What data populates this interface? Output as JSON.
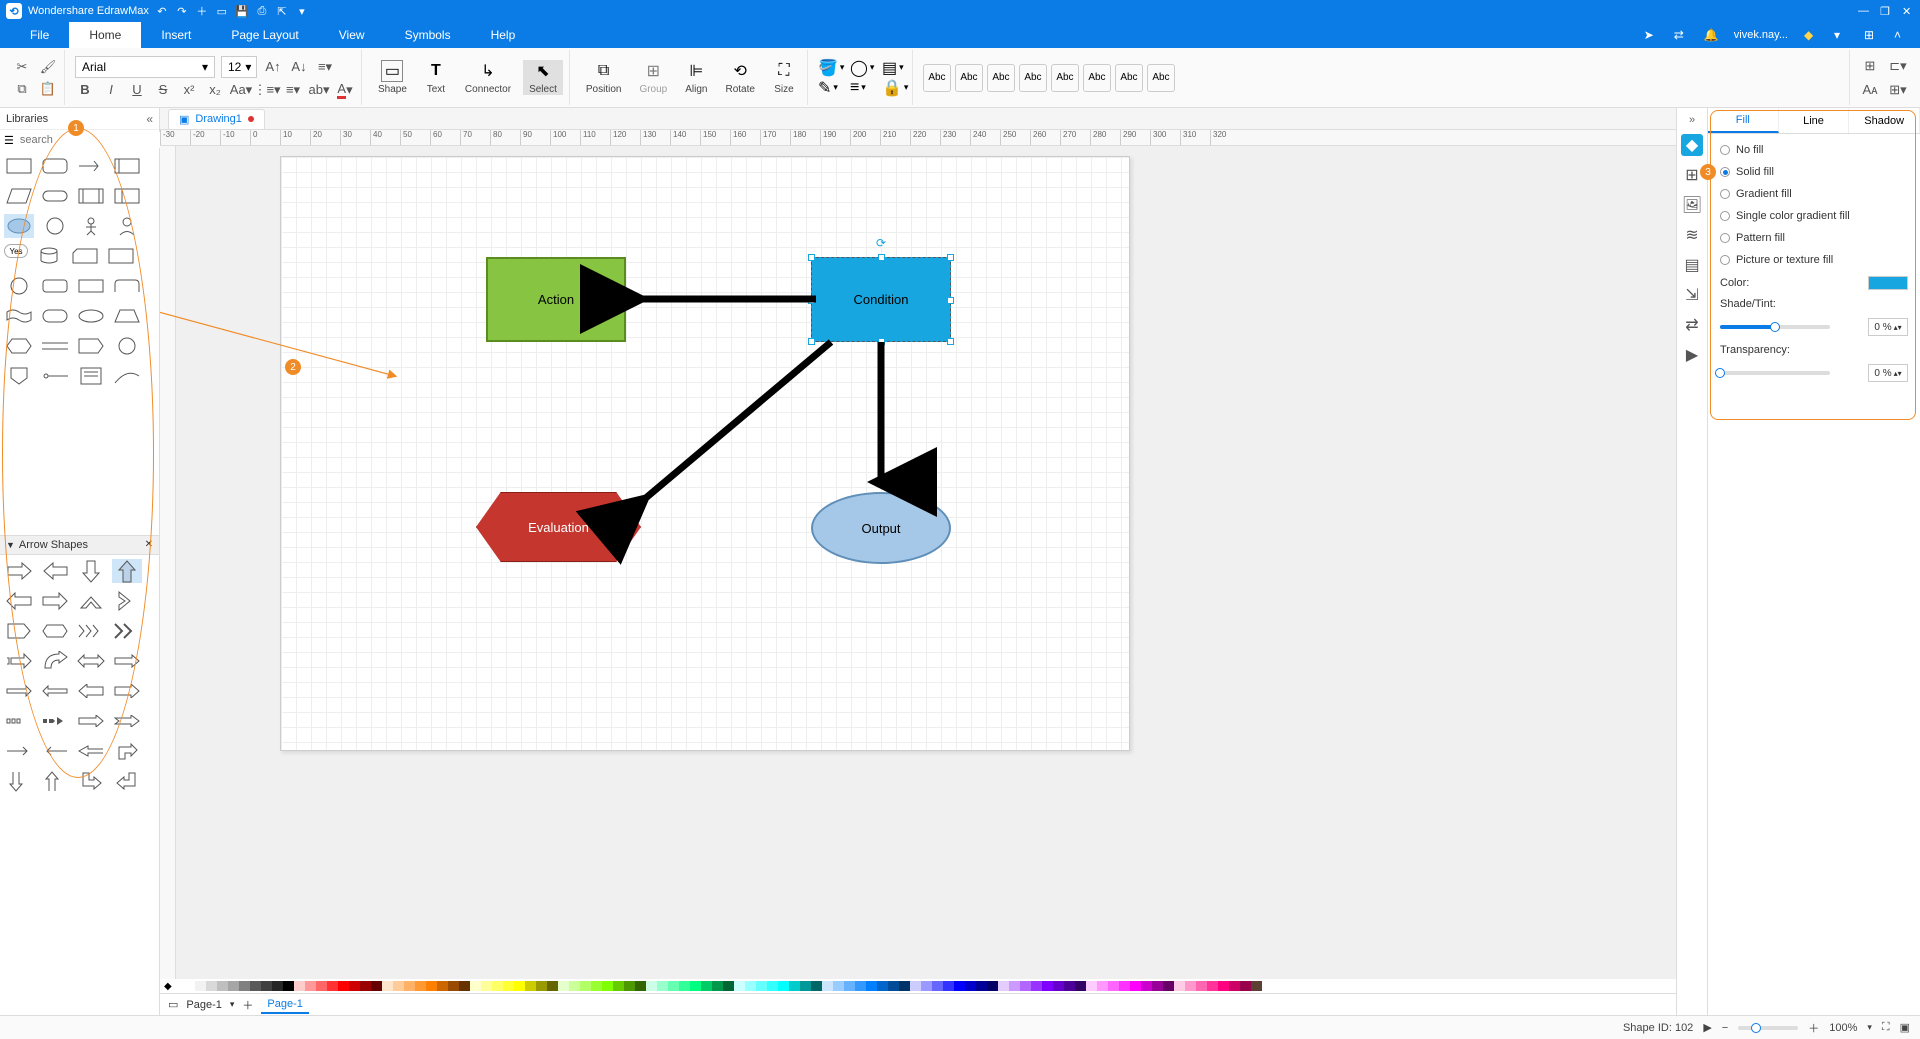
{
  "app": {
    "title": "Wondershare EdrawMax"
  },
  "menu": {
    "file": "File",
    "home": "Home",
    "insert": "Insert",
    "pagelayout": "Page Layout",
    "view": "View",
    "symbols": "Symbols",
    "help": "Help",
    "user": "vivek.nay..."
  },
  "ribbon": {
    "font": "Arial",
    "fontsize": "12",
    "shape": "Shape",
    "text": "Text",
    "connector": "Connector",
    "select": "Select",
    "position": "Position",
    "group": "Group",
    "align": "Align",
    "rotate": "Rotate",
    "size": "Size",
    "abc": "Abc"
  },
  "libraries": {
    "title": "Libraries",
    "search_ph": "search",
    "arrow_shapes": "Arrow Shapes"
  },
  "tabs": {
    "drawing": "Drawing1"
  },
  "canvas": {
    "action": "Action",
    "condition": "Condition",
    "evaluation": "Evaluation",
    "output": "Output"
  },
  "ruler": [
    "-30",
    "-20",
    "-10",
    "0",
    "10",
    "20",
    "30",
    "40",
    "50",
    "60",
    "70",
    "80",
    "90",
    "100",
    "110",
    "120",
    "130",
    "140",
    "150",
    "160",
    "170",
    "180",
    "190",
    "200",
    "210",
    "220",
    "230",
    "240",
    "250",
    "260",
    "270",
    "280",
    "290",
    "300",
    "310",
    "320"
  ],
  "props": {
    "fill": "Fill",
    "line": "Line",
    "shadow": "Shadow",
    "nofill": "No fill",
    "solid": "Solid fill",
    "gradient": "Gradient fill",
    "singlegrad": "Single color gradient fill",
    "pattern": "Pattern fill",
    "picture": "Picture or texture fill",
    "color": "Color:",
    "shade": "Shade/Tint:",
    "transparency": "Transparency:",
    "shade_val": "0 %",
    "trans_val": "0 %"
  },
  "pagebar": {
    "page": "Page-1",
    "pagetab": "Page-1"
  },
  "status": {
    "shapeid": "Shape ID: 102",
    "zoom": "100%"
  },
  "annotations": {
    "b1": "1",
    "b2": "2",
    "b3": "3"
  },
  "palette": [
    "#ffffff",
    "#f2f2f2",
    "#d9d9d9",
    "#bfbfbf",
    "#a6a6a6",
    "#808080",
    "#595959",
    "#404040",
    "#262626",
    "#000000",
    "#ffcccc",
    "#ff9999",
    "#ff6666",
    "#ff3333",
    "#ff0000",
    "#cc0000",
    "#990000",
    "#660000",
    "#ffe5cc",
    "#ffcc99",
    "#ffb266",
    "#ff9933",
    "#ff8000",
    "#cc6600",
    "#994c00",
    "#663300",
    "#ffffcc",
    "#ffff99",
    "#ffff66",
    "#ffff33",
    "#ffff00",
    "#cccc00",
    "#999900",
    "#666600",
    "#e5ffcc",
    "#ccff99",
    "#b2ff66",
    "#99ff33",
    "#80ff00",
    "#66cc00",
    "#4c9900",
    "#336600",
    "#ccffe5",
    "#99ffcc",
    "#66ffb2",
    "#33ff99",
    "#00ff80",
    "#00cc66",
    "#00994c",
    "#006633",
    "#ccffff",
    "#99ffff",
    "#66ffff",
    "#33ffff",
    "#00ffff",
    "#00cccc",
    "#009999",
    "#006666",
    "#cce5ff",
    "#99ccff",
    "#66b2ff",
    "#3399ff",
    "#0080ff",
    "#0066cc",
    "#004c99",
    "#003366",
    "#ccccff",
    "#9999ff",
    "#6666ff",
    "#3333ff",
    "#0000ff",
    "#0000cc",
    "#000099",
    "#000066",
    "#e5ccff",
    "#cc99ff",
    "#b266ff",
    "#9933ff",
    "#8000ff",
    "#6600cc",
    "#4c0099",
    "#330066",
    "#ffccff",
    "#ff99ff",
    "#ff66ff",
    "#ff33ff",
    "#ff00ff",
    "#cc00cc",
    "#990099",
    "#660066",
    "#ffcce5",
    "#ff99cc",
    "#ff66b2",
    "#ff3399",
    "#ff0080",
    "#cc0066",
    "#99004c",
    "#5c4033"
  ]
}
